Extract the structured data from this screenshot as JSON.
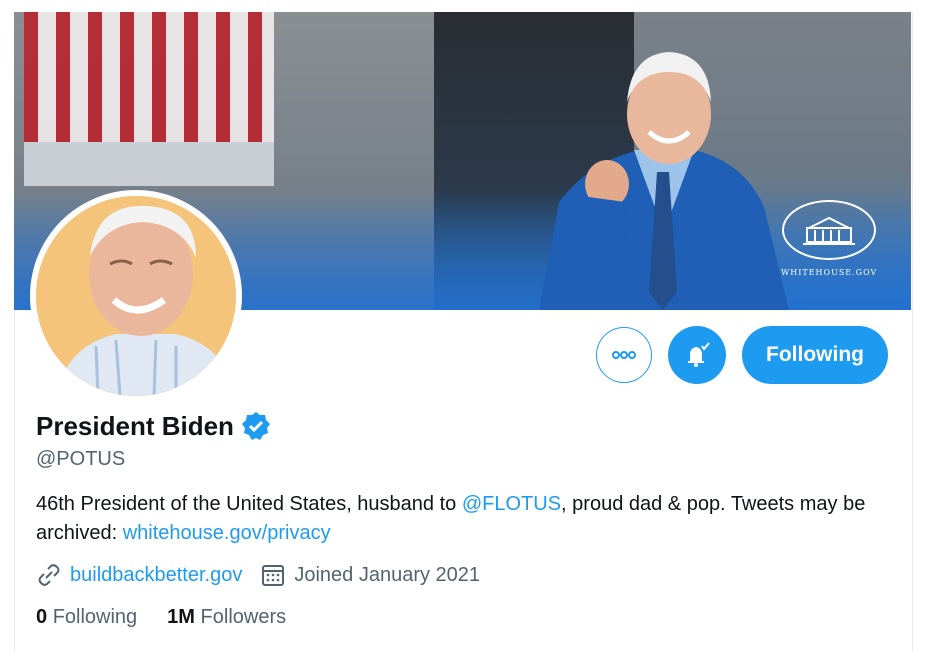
{
  "banner": {
    "logo_text": "WHITEHOUSE.GOV"
  },
  "actions": {
    "more_icon": "more-horizontal-icon",
    "bell_icon": "notification-bell-icon",
    "following_label": "Following"
  },
  "profile": {
    "name": "President Biden",
    "verified_icon": "verified-badge-icon",
    "handle": "@POTUS",
    "bio_part1": "46th President of the United States, husband to ",
    "bio_mention": "@FLOTUS",
    "bio_part2": ", proud dad & pop. Tweets may be archived: ",
    "bio_link": "whitehouse.gov/privacy",
    "website": "buildbackbetter.gov",
    "joined": "Joined January 2021"
  },
  "stats": {
    "following_count": "0",
    "following_label": "Following",
    "followers_count": "1M",
    "followers_label": "Followers"
  },
  "colors": {
    "accent": "#1d9bf0",
    "secondary_text": "#536471",
    "primary_text": "#0f1419"
  }
}
